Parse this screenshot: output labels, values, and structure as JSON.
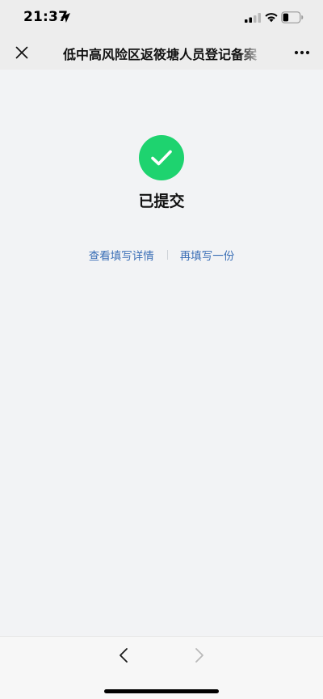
{
  "status_bar": {
    "time": "21:37",
    "icons": [
      "location-arrow-icon",
      "cellular-signal-icon",
      "wifi-icon",
      "battery-icon"
    ]
  },
  "nav": {
    "title": "低中高风险区返筱塘人员登记备案",
    "close_icon": "close-icon",
    "more_icon": "more-dots-icon"
  },
  "result": {
    "icon": "check-circle-icon",
    "title": "已提交",
    "view_details_label": "查看填写详情",
    "refill_label": "再填写一份"
  },
  "toolbar": {
    "back_icon": "chevron-left-icon",
    "forward_icon": "chevron-right-icon",
    "forward_enabled": false
  },
  "colors": {
    "success_green": "#1ed36f",
    "link_blue": "#3b6fb6",
    "background": "#f2f3f5",
    "header_gray": "#ededed"
  }
}
